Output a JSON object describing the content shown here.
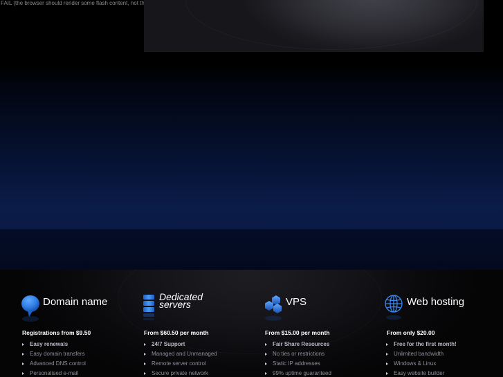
{
  "flash_fallback": {
    "text": "FAIL (the browser should render some flash content, not this)."
  },
  "colors": {
    "icon_blue": "#2f7fe6",
    "icon_blue_dark": "#1a4fb0",
    "price_text": "#ffffff",
    "muted_text": "#8f8f9c"
  },
  "products": [
    {
      "title": "Domain name",
      "title_line2": "",
      "icon": "speech-bubble-icon",
      "price": "Registrations from $9.50",
      "features": [
        "Easy renewals",
        "Easy domain transfers",
        "Advanced DNS control",
        "Personalised e-mail"
      ]
    },
    {
      "title": "Dedicated",
      "title_line2": "servers",
      "icon": "server-stack-icon",
      "price": "From $60.50 per month",
      "features": [
        "24/7 Support",
        "Managed and Unmanaged",
        "Remote server control",
        "Secure private network"
      ]
    },
    {
      "title": "VPS",
      "title_line2": "",
      "icon": "hexagon-cluster-icon",
      "price": "From $15.00 per month",
      "features": [
        "Fair Share Resources",
        "No ties or restrictions",
        "Static IP addresses",
        "99% uptime guaranteed"
      ]
    },
    {
      "title": "Web hosting",
      "title_line2": "",
      "icon": "globe-icon",
      "price": "From only $20.00",
      "features": [
        "Free for the first month!",
        "Unlimited bandwidth",
        "Windows & Linux",
        "Easy website builder"
      ]
    }
  ]
}
